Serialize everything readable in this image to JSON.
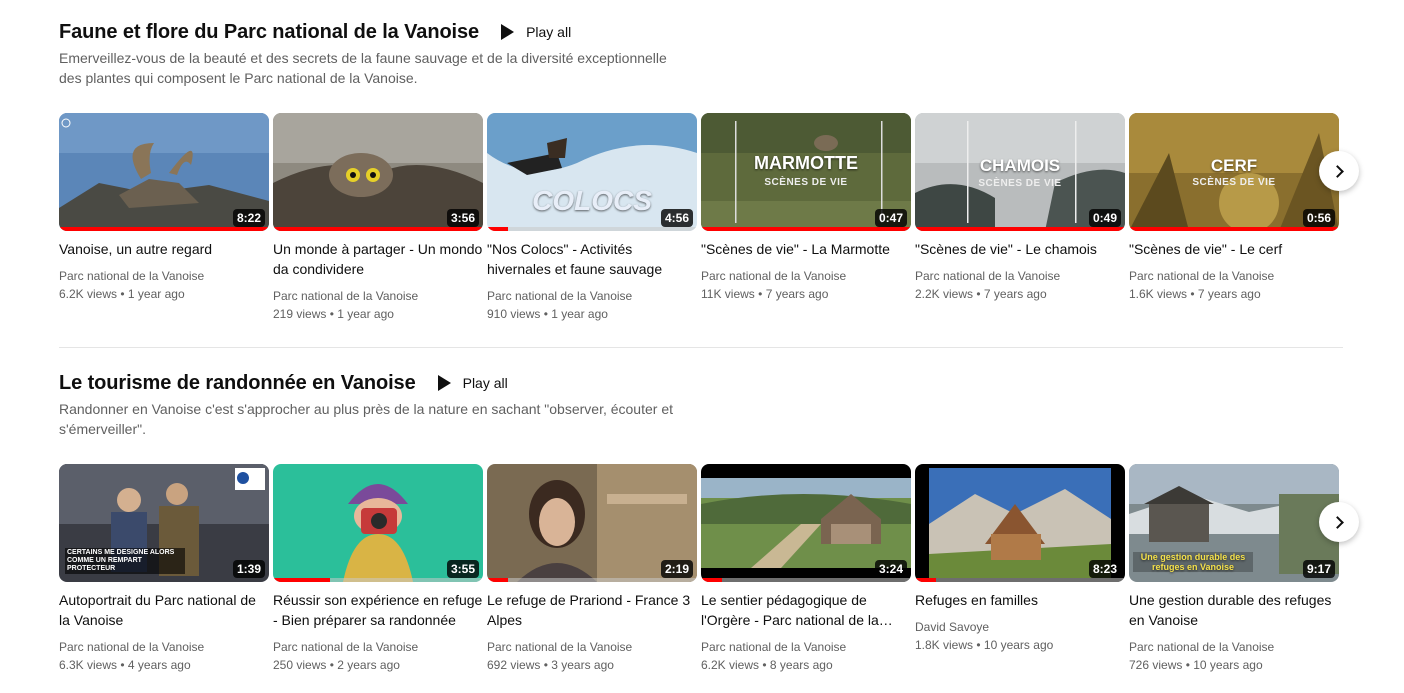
{
  "shelves": [
    {
      "title": "Faune et flore du Parc national de la Vanoise",
      "play_all": "Play all",
      "description": "Emerveillez-vous de la beauté et des secrets de la faune sauvage et de la diversité exceptionnelle des plantes qui composent le Parc national de la Vanoise.",
      "videos": [
        {
          "title": "Vanoise, un autre regard",
          "channel": "Parc national de la Vanoise",
          "views": "6.2K views",
          "age": "1 year ago",
          "duration": "8:22",
          "overlay": ""
        },
        {
          "title": "Un monde à partager - Un mondo da condividere",
          "channel": "Parc national de la Vanoise",
          "views": "219 views",
          "age": "1 year ago",
          "duration": "3:56",
          "overlay": ""
        },
        {
          "title": "\"Nos Colocs\" - Activités hivernales et faune sauvage",
          "channel": "Parc national de la Vanoise",
          "views": "910 views",
          "age": "1 year ago",
          "duration": "4:56",
          "overlay": "COLOCS"
        },
        {
          "title": "\"Scènes de vie\" - La Marmotte",
          "channel": "Parc national de la Vanoise",
          "views": "11K views",
          "age": "7 years ago",
          "duration": "0:47",
          "overlay": "MARMOTTE",
          "overlay_sub": "SCÈNES DE VIE"
        },
        {
          "title": "\"Scènes de vie\" - Le chamois",
          "channel": "Parc national de la Vanoise",
          "views": "2.2K views",
          "age": "7 years ago",
          "duration": "0:49",
          "overlay": "CHAMOIS",
          "overlay_sub": "SCÈNES DE VIE"
        },
        {
          "title": "\"Scènes de vie\" - Le cerf",
          "channel": "Parc national de la Vanoise",
          "views": "1.6K views",
          "age": "7 years ago",
          "duration": "0:56",
          "overlay": "CERF",
          "overlay_sub": "SCÈNES DE VIE"
        }
      ]
    },
    {
      "title": "Le tourisme de randonnée en Vanoise",
      "play_all": "Play all",
      "description": "Randonner en Vanoise c'est s'approcher au plus près de la nature en sachant \"observer, écouter et s'émerveiller\".",
      "videos": [
        {
          "title": "Autoportrait du Parc national de la Vanoise",
          "channel": "Parc national de la Vanoise",
          "views": "6.3K views",
          "age": "4 years ago",
          "duration": "1:39",
          "overlay": "CERTAINS ME DESIGNE ALORS COMME UN REMPART PROTECTEUR"
        },
        {
          "title": "Réussir son expérience en refuge - Bien préparer sa randonnée",
          "channel": "Parc national de la Vanoise",
          "views": "250 views",
          "age": "2 years ago",
          "duration": "3:55",
          "overlay": ""
        },
        {
          "title": "Le refuge de Prariond - France 3 Alpes",
          "channel": "Parc national de la Vanoise",
          "views": "692 views",
          "age": "3 years ago",
          "duration": "2:19",
          "overlay": ""
        },
        {
          "title": "Le sentier pédagogique de l'Orgère - Parc national de la Vanoise",
          "channel": "Parc national de la Vanoise",
          "views": "6.2K views",
          "age": "8 years ago",
          "duration": "3:24",
          "overlay": ""
        },
        {
          "title": "Refuges en familles",
          "channel": "David Savoye",
          "views": "1.8K views",
          "age": "10 years ago",
          "duration": "8:23",
          "overlay": ""
        },
        {
          "title": "Une gestion durable des refuges en Vanoise",
          "channel": "Parc national de la Vanoise",
          "views": "726 views",
          "age": "10 years ago",
          "duration": "9:17",
          "overlay": "Une gestion durable des refuges en Vanoise"
        }
      ]
    }
  ],
  "icons": {
    "play": "play-icon",
    "next": "chevron-right-icon"
  },
  "colors": {
    "progress": "#ff0000",
    "text": "#0f0f0f",
    "secondary": "#606060"
  }
}
